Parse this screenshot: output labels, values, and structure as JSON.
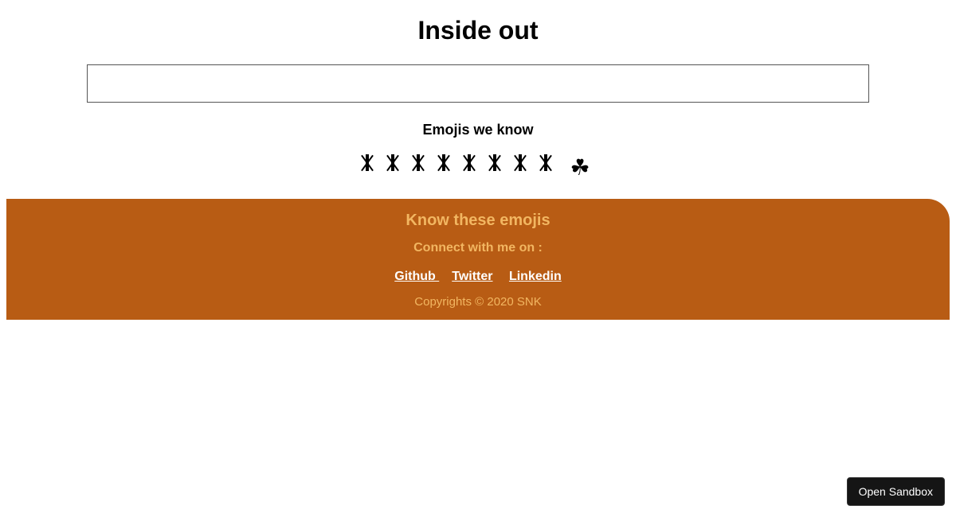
{
  "header": {
    "title": "Inside out"
  },
  "input": {
    "value": "",
    "placeholder": ""
  },
  "emojis": {
    "heading": "Emojis we know",
    "items": [
      {
        "name": "emoji-1",
        "glyph": ""
      },
      {
        "name": "emoji-2",
        "glyph": ""
      },
      {
        "name": "emoji-3",
        "glyph": ""
      },
      {
        "name": "emoji-4",
        "glyph": ""
      },
      {
        "name": "emoji-5",
        "glyph": ""
      },
      {
        "name": "emoji-6",
        "glyph": ""
      },
      {
        "name": "emoji-7",
        "glyph": ""
      },
      {
        "name": "emoji-8",
        "glyph": ""
      },
      {
        "name": "shamrock",
        "glyph": "☘"
      }
    ]
  },
  "footer": {
    "title": "Know these emojis",
    "connect": "Connect with me on :",
    "links": [
      {
        "label": "Github "
      },
      {
        "label": "Twitter"
      },
      {
        "label": "Linkedin"
      }
    ],
    "copyright": "Copyrights © 2020 SNK"
  },
  "sandbox": {
    "label": "Open Sandbox"
  }
}
